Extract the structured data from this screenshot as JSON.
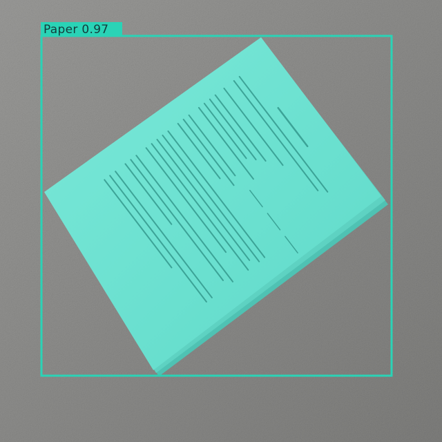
{
  "detection": {
    "label": "Paper",
    "confidence": "0.97",
    "box_color": "#2ad3b6"
  },
  "scene": {
    "object": "stack-of-paper",
    "paper_color": "#6fe3d3",
    "floor_color": "#8a8a88"
  }
}
